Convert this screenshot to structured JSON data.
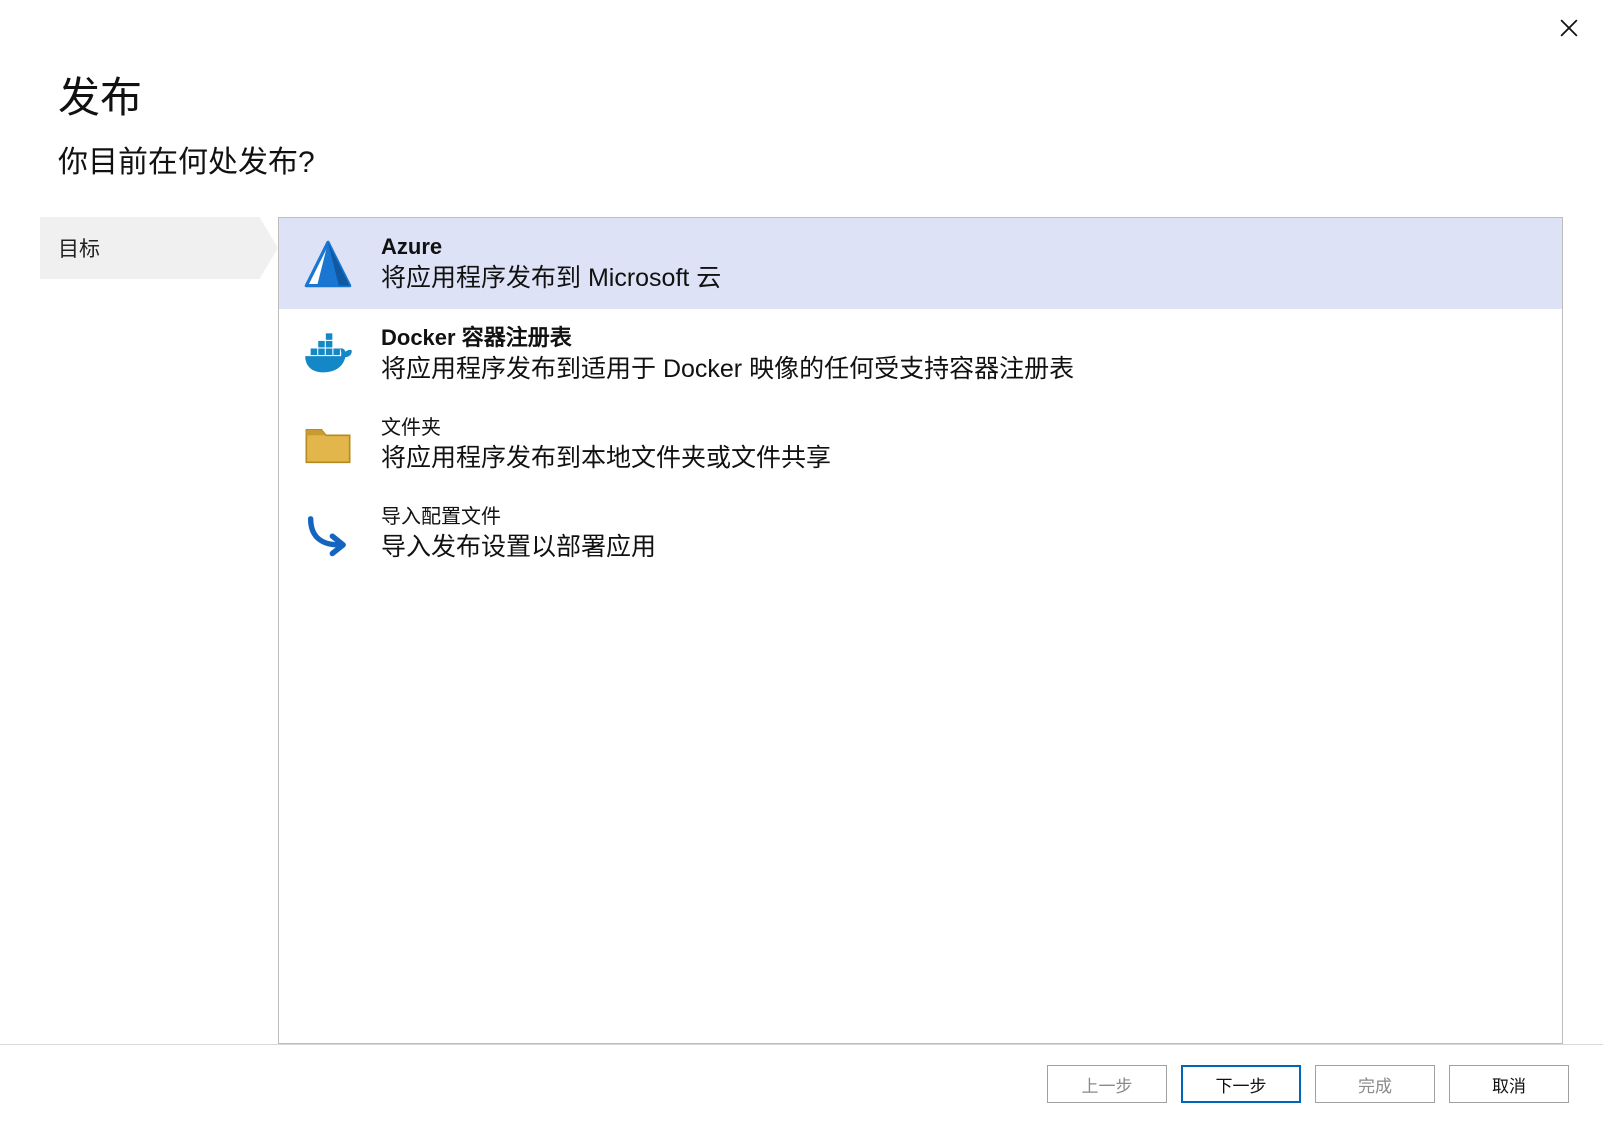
{
  "header": {
    "title": "发布",
    "subtitle": "你目前在何处发布?"
  },
  "steps": {
    "items": [
      {
        "label": "目标"
      }
    ]
  },
  "options": [
    {
      "title": "Azure",
      "desc": "将应用程序发布到 Microsoft 云",
      "selected": true
    },
    {
      "title": "Docker 容器注册表",
      "desc": "将应用程序发布到适用于 Docker 映像的任何受支持容器注册表",
      "selected": false
    },
    {
      "title": "文件夹",
      "desc": "将应用程序发布到本地文件夹或文件共享",
      "selected": false
    },
    {
      "title": "导入配置文件",
      "desc": "导入发布设置以部署应用",
      "selected": false
    }
  ],
  "footer": {
    "back": "上一步",
    "next": "下一步",
    "finish": "完成",
    "cancel": "取消"
  }
}
